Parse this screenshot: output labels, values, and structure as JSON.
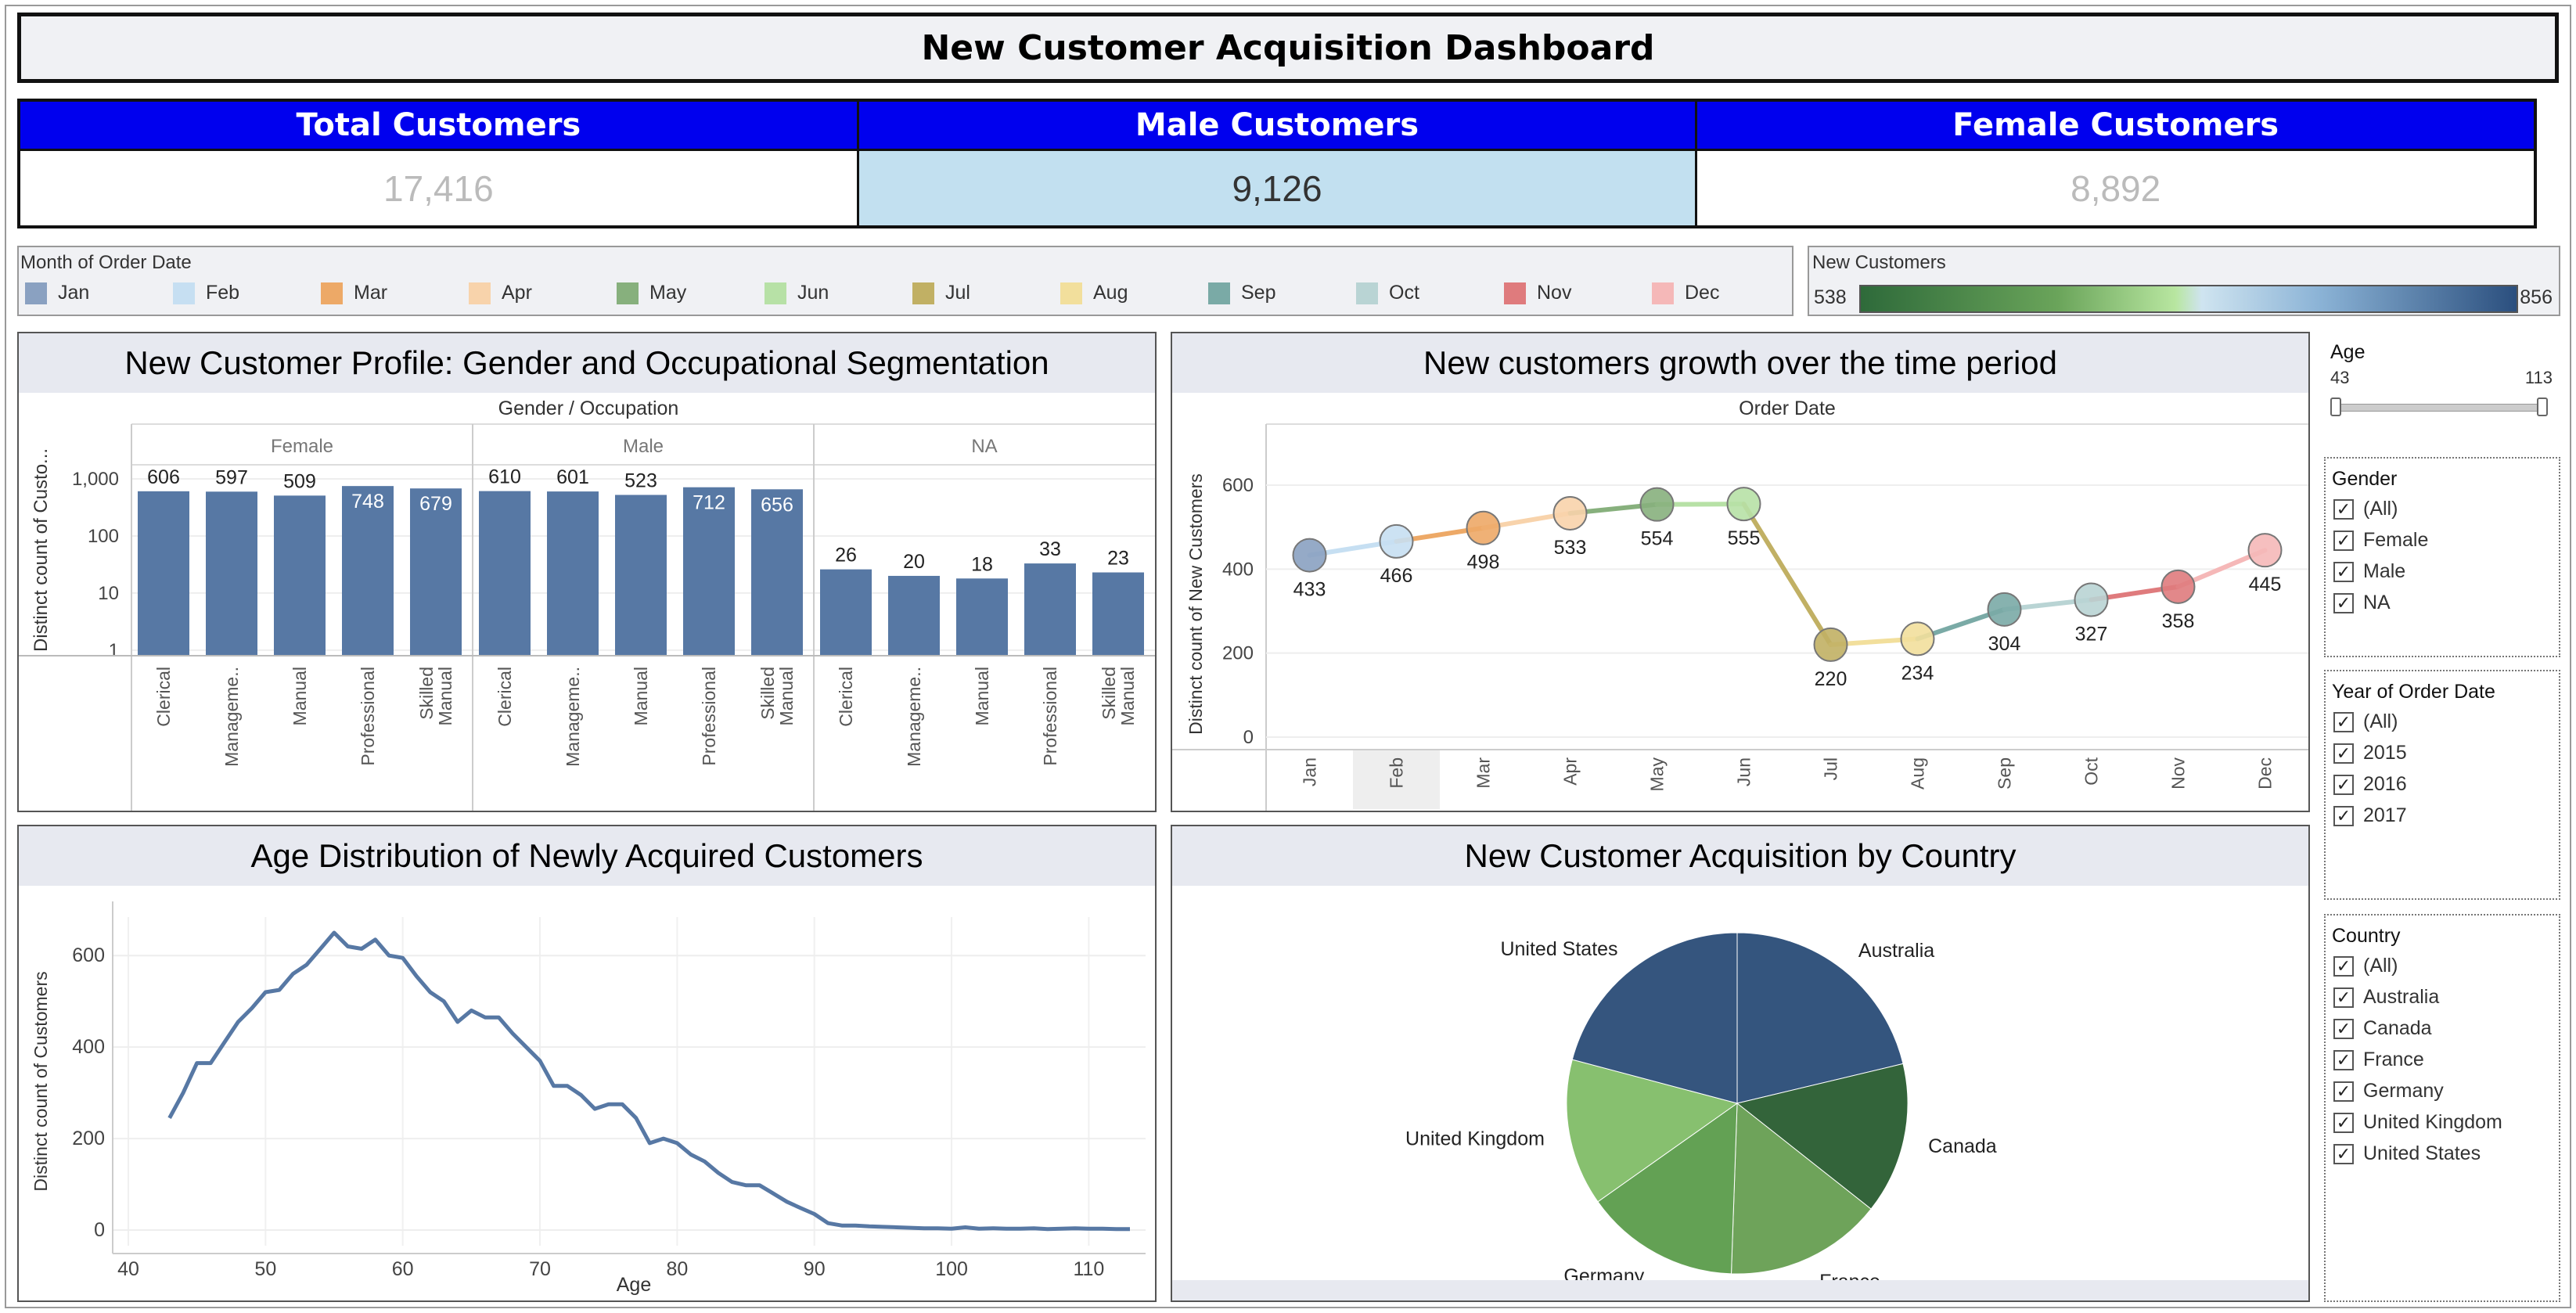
{
  "dashboard_title": "New Customer Acquisition Dashboard",
  "kpis": [
    {
      "label": "Total Customers",
      "value": "17,416",
      "selected": false
    },
    {
      "label": "Male Customers",
      "value": "9,126",
      "selected": true
    },
    {
      "label": "Female Customers",
      "value": "8,892",
      "selected": false
    }
  ],
  "month_legend": {
    "title": "Month of Order Date",
    "items": [
      {
        "label": "Jan",
        "color": "#8aa1c1"
      },
      {
        "label": "Feb",
        "color": "#c6dff2"
      },
      {
        "label": "Mar",
        "color": "#eda967"
      },
      {
        "label": "Apr",
        "color": "#f8d3ab"
      },
      {
        "label": "May",
        "color": "#87b07d"
      },
      {
        "label": "Jun",
        "color": "#b7e1a6"
      },
      {
        "label": "Jul",
        "color": "#c1b064"
      },
      {
        "label": "Aug",
        "color": "#f2df9c"
      },
      {
        "label": "Sep",
        "color": "#7aaaa6"
      },
      {
        "label": "Oct",
        "color": "#b9d4d4"
      },
      {
        "label": "Nov",
        "color": "#df7b7d"
      },
      {
        "label": "Dec",
        "color": "#f5b8b8"
      }
    ]
  },
  "new_customers_legend": {
    "title": "New Customers",
    "min": "538",
    "max": "856"
  },
  "filters": {
    "age": {
      "title": "Age",
      "min": "43",
      "max": "113"
    },
    "gender": {
      "title": "Gender",
      "options": [
        "(All)",
        "Female",
        "Male",
        "NA"
      ]
    },
    "year": {
      "title": "Year of Order Date",
      "options": [
        "(All)",
        "2015",
        "2016",
        "2017"
      ]
    },
    "country": {
      "title": "Country",
      "options": [
        "(All)",
        "Australia",
        "Canada",
        "France",
        "Germany",
        "United Kingdom",
        "United States"
      ]
    }
  },
  "panels": {
    "profile_title": "New Customer Profile: Gender and Occupational Segmentation",
    "growth_title": "New customers growth over the time period",
    "age_title": "Age Distribution of Newly Acquired Customers",
    "country_title": "New Customer Acquisition by Country"
  },
  "chart_data": [
    {
      "type": "bar",
      "title": "New Customer Profile: Gender and Occupational Segmentation",
      "header": "Gender / Occupation",
      "ylabel": "Distinct count of Custo...",
      "yscale": "log",
      "yticks": [
        "1",
        "10",
        "100",
        "1,000"
      ],
      "groups": [
        "Female",
        "Male",
        "NA"
      ],
      "categories": [
        "Clerical",
        "Management",
        "Manual",
        "Professional",
        "Skilled Manual"
      ],
      "category_labels": [
        "Clerical",
        "Manageme..",
        "Manual",
        "Professional",
        "Skilled Manual"
      ],
      "series": [
        {
          "name": "Female",
          "values": [
            606,
            597,
            509,
            748,
            679
          ]
        },
        {
          "name": "Male",
          "values": [
            610,
            601,
            523,
            712,
            656
          ]
        },
        {
          "name": "NA",
          "values": [
            26,
            20,
            18,
            33,
            23
          ]
        }
      ],
      "bar_color": "#5778a4",
      "grid": true
    },
    {
      "type": "line",
      "title": "New customers growth over the time period",
      "header": "Order Date",
      "ylabel": "Distinct count of New Customers",
      "categories": [
        "Jan",
        "Feb",
        "Mar",
        "Apr",
        "May",
        "Jun",
        "Jul",
        "Aug",
        "Sep",
        "Oct",
        "Nov",
        "Dec"
      ],
      "values": [
        433,
        466,
        498,
        533,
        554,
        555,
        220,
        234,
        304,
        327,
        358,
        445
      ],
      "ylim": [
        0,
        600
      ],
      "yticks": [
        0,
        200,
        400,
        600
      ],
      "highlighted_category": "Feb",
      "grid": true
    },
    {
      "type": "line",
      "title": "Age Distribution of Newly Acquired Customers",
      "xlabel": "Age",
      "ylabel": "Distinct count of Customers",
      "xlim": [
        40,
        113
      ],
      "ylim": [
        0,
        650
      ],
      "xticks": [
        40,
        50,
        60,
        70,
        80,
        90,
        100,
        110
      ],
      "yticks": [
        0,
        200,
        400,
        600
      ],
      "x": [
        43,
        44,
        45,
        46,
        47,
        48,
        49,
        50,
        51,
        52,
        53,
        54,
        55,
        56,
        57,
        58,
        59,
        60,
        61,
        62,
        63,
        64,
        65,
        66,
        67,
        68,
        69,
        70,
        71,
        72,
        73,
        74,
        75,
        76,
        77,
        78,
        79,
        80,
        81,
        82,
        83,
        84,
        85,
        86,
        87,
        88,
        89,
        90,
        91,
        92,
        93,
        94,
        95,
        96,
        97,
        98,
        99,
        100,
        101,
        102,
        103,
        104,
        105,
        106,
        107,
        108,
        109,
        110,
        111,
        112,
        113
      ],
      "values": [
        245,
        300,
        365,
        365,
        410,
        455,
        485,
        520,
        525,
        560,
        580,
        615,
        650,
        620,
        615,
        635,
        600,
        595,
        555,
        520,
        500,
        455,
        480,
        465,
        465,
        430,
        400,
        370,
        315,
        315,
        295,
        265,
        275,
        275,
        245,
        190,
        200,
        190,
        165,
        150,
        125,
        105,
        98,
        98,
        80,
        62,
        48,
        35,
        15,
        10,
        10,
        8,
        7,
        6,
        5,
        4,
        4,
        3,
        6,
        3,
        4,
        3,
        3,
        4,
        2,
        3,
        4,
        3,
        3,
        2,
        2
      ],
      "line_color": "#5778a4",
      "grid": true
    },
    {
      "type": "pie",
      "title": "New Customer Acquisition by Country",
      "labels": [
        "Australia",
        "Canada",
        "France",
        "Germany",
        "United Kingdom",
        "United States"
      ],
      "values": [
        856,
        578,
        600,
        590,
        560,
        840
      ],
      "colors": [
        "#34557e",
        "#33643a",
        "#6ea35a",
        "#63a154",
        "#87c06f",
        "#35557e"
      ]
    }
  ]
}
